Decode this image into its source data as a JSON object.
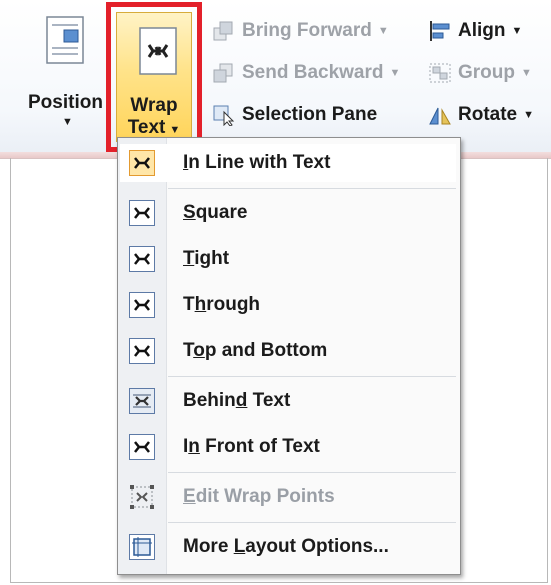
{
  "ribbon": {
    "position_label": "Position",
    "wrap_label_line1": "Wrap",
    "wrap_label_line2": "Text",
    "bring_forward": "Bring Forward",
    "send_backward": "Send Backward",
    "selection_pane": "Selection Pane",
    "align": "Align",
    "group": "Group",
    "rotate": "Rotate"
  },
  "menu": {
    "items": [
      {
        "pre": "",
        "u": "I",
        "post": "n Line with Text",
        "state": "highlighted"
      },
      {
        "pre": "",
        "u": "S",
        "post": "quare",
        "state": "normal"
      },
      {
        "pre": "",
        "u": "T",
        "post": "ight",
        "state": "normal"
      },
      {
        "pre": "T",
        "u": "h",
        "post": "rough",
        "state": "normal"
      },
      {
        "pre": "T",
        "u": "o",
        "post": "p and Bottom",
        "state": "normal"
      },
      {
        "pre": "Behin",
        "u": "d",
        "post": " Text",
        "state": "normal"
      },
      {
        "pre": "I",
        "u": "n",
        "post": " Front of Text",
        "state": "normal"
      },
      {
        "pre": "",
        "u": "E",
        "post": "dit Wrap Points",
        "state": "disabled"
      },
      {
        "pre": "More ",
        "u": "L",
        "post": "ayout Options...",
        "state": "normal"
      }
    ]
  },
  "colors": {
    "highlight_border": "#e3202a",
    "button_active": "#ffe38a",
    "disabled_text": "#9a9fa6"
  },
  "icons": {
    "position": "position-icon",
    "wrap": "wrap-text-icon",
    "bring_forward": "bring-forward-icon",
    "send_backward": "send-backward-icon",
    "selection_pane": "selection-pane-icon",
    "align": "align-icon",
    "group": "group-icon",
    "rotate": "rotate-icon"
  }
}
